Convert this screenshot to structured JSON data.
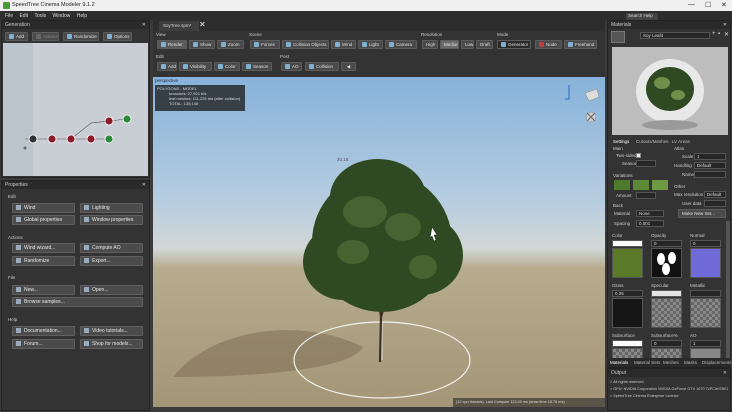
{
  "window": {
    "title": "SpeedTree Cinema Modeler 9.1.2",
    "min": "—",
    "max": "☐",
    "close": "✕"
  },
  "menu": [
    "File",
    "Edit",
    "Tools",
    "Window",
    "Help"
  ],
  "generation": {
    "title": "Generation",
    "buttons": {
      "add": "Add",
      "actions": "Actions",
      "randomize": "Randomize",
      "options": "Options"
    }
  },
  "properties": {
    "title": "Properties",
    "edit_label": "Edit",
    "wind": "Wind",
    "lighting": "Lighting",
    "global_properties": "Global properties",
    "window_properties": "Window properties",
    "actions_label": "Actions",
    "wind_wizard": "Wind wizard...",
    "compute_ao": "Compute AO",
    "randomize": "Randomize",
    "export": "Export...",
    "file_label": "File",
    "new": "New...",
    "open": "Open...",
    "browse_samples": "Browse samples...",
    "help_label": "Help",
    "documentation": "Documentation...",
    "video_tutorials": "Video tutorials...",
    "forum": "Forum...",
    "shop": "Shop for models..."
  },
  "document_tab": {
    "label": "SoyTree.spm*",
    "close": "✕"
  },
  "toolbar": {
    "view_label": "View",
    "render": "Render",
    "show": "Show",
    "zoom": "Zoom",
    "scene_label": "Scene",
    "forces": "Forces",
    "collision_objects": "Collision Objects",
    "wind": "Wind",
    "light": "Light",
    "camera": "Camera",
    "resolution_label": "Resolution",
    "high": "High",
    "medium": "Medium",
    "low": "Low",
    "draft": "Draft",
    "mode_label": "Mode",
    "generator": "Generator",
    "node": "Node",
    "freehand": "Freehand",
    "edit_label": "Edit",
    "add": "Add",
    "visibility": "Visibility",
    "color": "Color",
    "season": "Season",
    "post_label": "Post",
    "ao": "AO",
    "collision": "Collision"
  },
  "viewport": {
    "camera_label": "perspective",
    "stats_title": "POLYGONS - MODEL",
    "stats_line1": "branches: 27,921 tris",
    "stats_line2": "leaf meshes: 111,225 tris (after collision)",
    "stats_total": "TOTAL: 139,146",
    "height_readout": "20.18",
    "status": "(12 cpu threads), Last Compute 113.45 ms (draw time 18.76 ms)"
  },
  "materials": {
    "title": "Materials",
    "search_placeholder": "Search Help",
    "name": "Soy Leaf4",
    "tabs": [
      "Settings",
      "Cutouts/Meshes",
      "LV Areas"
    ],
    "main_label": "Main",
    "two_sided": "Two-sided",
    "season": "Season",
    "atlas_label": "Atlas",
    "scale": "Scale",
    "scale_value": "1",
    "handling": "Handling",
    "handling_value": "Default",
    "name_label": "Name",
    "variations_label": "Variations",
    "amount": "Amount",
    "other_label": "Other",
    "max_resolution": "Max resolution",
    "max_resolution_value": "Default",
    "user_data": "User data",
    "make_new_set": "Make New Set...",
    "back_label": "Back",
    "material": "Material",
    "material_value": "None",
    "spacing": "Spacing",
    "spacing_value": "0.001",
    "maps": {
      "color": "Color",
      "opacity": "Opacity",
      "opacity_value": "0",
      "normal": "Normal",
      "normal_value": "0",
      "gloss": "Gloss",
      "gloss_value": "0.25",
      "specular": "Specular",
      "metallic": "Metallic",
      "subsurface": "Subsurface",
      "subsurface_pct": "Subsurface%",
      "subsurface_pct_value": "0",
      "ao": "AO",
      "ao_value": "1"
    },
    "bottom_tabs": [
      "Materials",
      "Material Sets",
      "Meshes",
      "Masks",
      "Displacements"
    ]
  },
  "output": {
    "title": "Output",
    "lines": [
      "> All rights reserved.",
      "> GPU: NVIDIA Corporation NVIDIA GeForce GTX 1070 Ti/PCIe/SSE2",
      "> SpeedTree Cinema Enterprise License"
    ]
  },
  "colors": {
    "accent": "#7fb0d0",
    "leaf": "#3b5a2a",
    "sky_top": "#8fb7dc",
    "ground": "#9a8d72"
  }
}
